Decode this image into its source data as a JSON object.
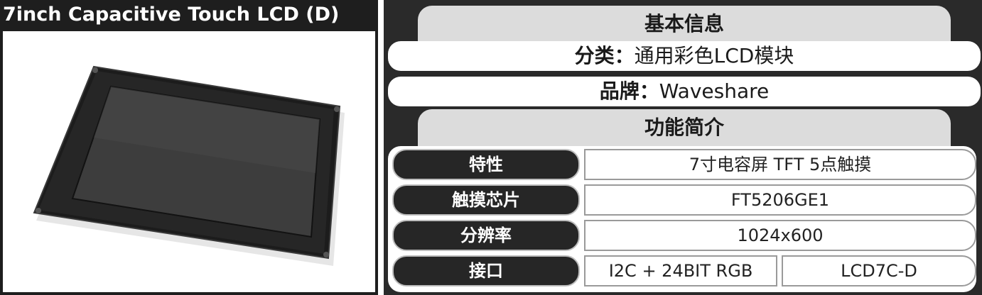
{
  "product": {
    "title": "7inch Capacitive Touch LCD (D)",
    "image_icon": "lcd-panel-photo"
  },
  "basic_info": {
    "heading": "基本信息",
    "category_label": "分类：",
    "category_value": "通用彩色LCD模块",
    "brand_label": "品牌：",
    "brand_value": "Waveshare"
  },
  "features": {
    "heading": "功能简介",
    "rows": [
      {
        "label": "特性",
        "value": "7寸电容屏 TFT 5点触摸"
      },
      {
        "label": "触摸芯片",
        "value": "FT5206GE1"
      },
      {
        "label": "分辨率",
        "value": "1024x600"
      },
      {
        "label": "接口",
        "values": [
          "I2C + 24BIT RGB",
          "LCD7C-D"
        ]
      }
    ]
  },
  "colors": {
    "dark": "#262626",
    "panel_bg": "#2a2a2a",
    "tab_bg": "#dcdcdc",
    "light": "#ffffff"
  }
}
